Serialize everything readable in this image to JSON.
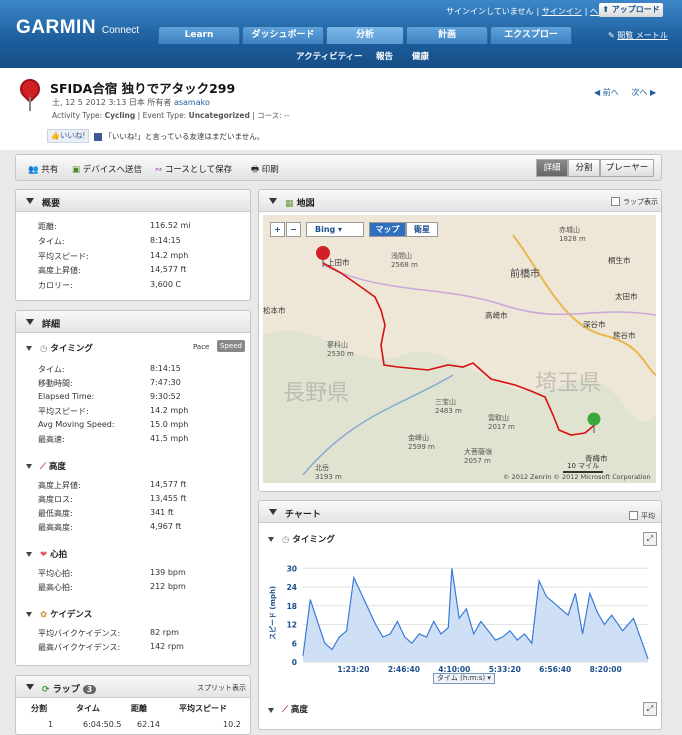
{
  "header": {
    "logo": "GARMIN",
    "logo_sub": "Connect",
    "links": [
      "サインインしていません",
      "サインイン",
      "ヘルプ"
    ],
    "upload_label": "アップロード",
    "right_link": "閲覧 メートル",
    "tabs": [
      {
        "label": "Learn",
        "active": false
      },
      {
        "label": "ダッシュボード",
        "active": false
      },
      {
        "label": "分析",
        "active": true
      },
      {
        "label": "計画",
        "active": false
      },
      {
        "label": "エクスプロー",
        "active": false
      }
    ],
    "subnav": [
      "アクティビティー",
      "報告",
      "健康"
    ]
  },
  "activity": {
    "title": "SFIDA合宿 独りでアタック299",
    "date": "土, 12 5 2012 3:13 日本 所有者",
    "owner": "asamako",
    "type_label": "Activity Type:",
    "type_value": "Cycling",
    "event_label": "| Event Type:",
    "event_value": "Uncategorized",
    "course_label": "| コース: --",
    "like_button": "いいね!",
    "like_text": "「いいね!」と言っている友達はまだいません。",
    "prev": "前へ",
    "next": "次へ"
  },
  "toolbar": {
    "share": "共有",
    "send": "デバイスへ送信",
    "save_course": "コースとして保存",
    "print": "印刷",
    "views": [
      "詳細",
      "分割",
      "プレーヤー"
    ]
  },
  "summary": {
    "title": "概要",
    "rows": [
      {
        "label": "距離:",
        "value": "116.52 mi"
      },
      {
        "label": "タイム:",
        "value": "8:14:15"
      },
      {
        "label": "平均スピード:",
        "value": "14.2 mph"
      },
      {
        "label": "高度上昇値:",
        "value": "14,577 ft"
      },
      {
        "label": "カロリー:",
        "value": "3,600 C"
      }
    ]
  },
  "details": {
    "title": "詳細",
    "timing": {
      "title": "タイミング",
      "toggle": [
        "Pace",
        "Speed"
      ],
      "rows": [
        {
          "label": "タイム:",
          "value": "8:14:15"
        },
        {
          "label": "移動時間:",
          "value": "7:47:30"
        },
        {
          "label": "Elapsed Time:",
          "value": "9:30:52"
        },
        {
          "label": "平均スピード:",
          "value": "14.2 mph"
        },
        {
          "label": "Avg Moving Speed:",
          "value": "15.0 mph"
        },
        {
          "label": "最高速:",
          "value": "41.5 mph"
        }
      ]
    },
    "elevation": {
      "title": "高度",
      "rows": [
        {
          "label": "高度上昇値:",
          "value": "14,577 ft"
        },
        {
          "label": "高度ロス:",
          "value": "13,455 ft"
        },
        {
          "label": "最低高度:",
          "value": "341 ft"
        },
        {
          "label": "最高高度:",
          "value": "4,967 ft"
        }
      ]
    },
    "heart": {
      "title": "心拍",
      "rows": [
        {
          "label": "平均心拍:",
          "value": "139 bpm"
        },
        {
          "label": "最高心拍:",
          "value": "212 bpm"
        }
      ]
    },
    "cadence": {
      "title": "ケイデンス",
      "rows": [
        {
          "label": "平均バイクケイデンス:",
          "value": "82 rpm"
        },
        {
          "label": "最高バイクケイデンス:",
          "value": "142 rpm"
        }
      ]
    }
  },
  "laps": {
    "title": "ラップ",
    "count": "3",
    "split_link": "スプリット表示",
    "headers": [
      "分割",
      "タイム",
      "距離",
      "平均スピード"
    ],
    "rows": [
      [
        "1",
        "6:04:50.5",
        "62.14",
        "10.2"
      ]
    ]
  },
  "map": {
    "title": "地図",
    "lap_label": "ラップ表示",
    "provider": "Bing",
    "btn_map": "マップ",
    "btn_sat": "衛星",
    "scale": "10 マイル",
    "copyright": "© 2012 Zenrin  © 2012 Microsoft Corporation",
    "places": [
      {
        "name": "浅間山",
        "sub": "2568 m"
      },
      {
        "name": "前橋市",
        "sub": ""
      },
      {
        "name": "蓼科山",
        "sub": "2530 m"
      },
      {
        "name": "長野県",
        "sub": ""
      },
      {
        "name": "埼玉県",
        "sub": ""
      },
      {
        "name": "三宝山",
        "sub": "2483 m"
      },
      {
        "name": "金峰山",
        "sub": "2599 m"
      },
      {
        "name": "雲取山",
        "sub": "2017 m"
      },
      {
        "name": "大菩薩嶺",
        "sub": "2057 m"
      },
      {
        "name": "北岳",
        "sub": "3193 m"
      },
      {
        "name": "上田市",
        "sub": ""
      },
      {
        "name": "高崎市",
        "sub": ""
      },
      {
        "name": "太田市",
        "sub": ""
      },
      {
        "name": "深谷市",
        "sub": ""
      },
      {
        "name": "熊谷市",
        "sub": ""
      },
      {
        "name": "松本市",
        "sub": ""
      },
      {
        "name": "赤城山",
        "sub": "1828 m"
      },
      {
        "name": "桐生市",
        "sub": ""
      },
      {
        "name": "青梅市",
        "sub": ""
      }
    ]
  },
  "chart_panel": {
    "title": "チャート",
    "flat_label": "平均",
    "timing_label": "タイミング",
    "elev_label": "高度",
    "xaxis_select": "タイム (h:m:s)"
  },
  "chart_data": {
    "type": "area",
    "title": "タイミング",
    "xlabel": "タイム (h:m:s)",
    "ylabel": "スピード (mph)",
    "ylim": [
      0,
      32
    ],
    "yticks": [
      0,
      6,
      12,
      18,
      24,
      30
    ],
    "xticks": [
      "1:23:20",
      "2:46:40",
      "4:10:00",
      "5:33:20",
      "6:56:40",
      "8:20:00"
    ],
    "color": "#3a7bd5",
    "x": [
      0,
      0.2,
      0.4,
      0.6,
      0.8,
      1.0,
      1.2,
      1.4,
      1.6,
      1.8,
      2.0,
      2.2,
      2.4,
      2.6,
      2.8,
      3.0,
      3.2,
      3.4,
      3.6,
      3.8,
      4.0,
      4.1,
      4.3,
      4.5,
      4.7,
      4.9,
      5.1,
      5.3,
      5.5,
      5.7,
      5.9,
      6.1,
      6.3,
      6.5,
      6.7,
      6.9,
      7.1,
      7.3,
      7.5,
      7.7,
      7.9,
      8.1,
      8.3,
      8.5,
      8.8,
      9.1,
      9.5
    ],
    "values": [
      2,
      20,
      13,
      6,
      4,
      8,
      10,
      27,
      22,
      17,
      12,
      8,
      9,
      13,
      8,
      6,
      9,
      8,
      13,
      9,
      11,
      30,
      14,
      17,
      9,
      13,
      10,
      7,
      8,
      10,
      7,
      9,
      6,
      26,
      21,
      19,
      17,
      15,
      22,
      9,
      22,
      16,
      12,
      15,
      10,
      14,
      1
    ]
  }
}
